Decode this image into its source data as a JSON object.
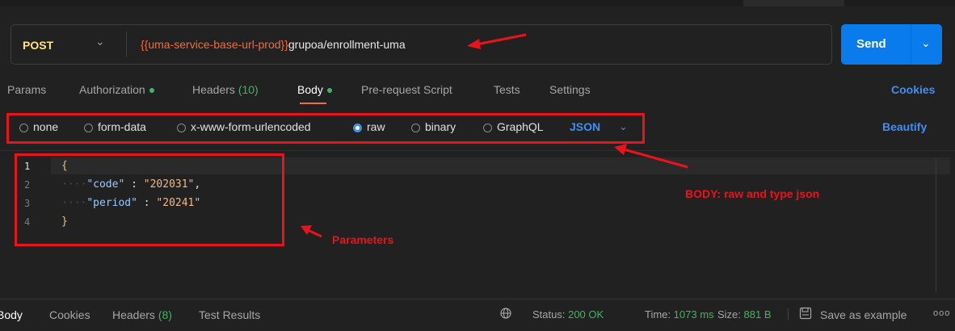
{
  "request": {
    "method": "POST",
    "url_var": "{{uma-service-base-url-prod}}",
    "url_path": "grupoa/enrollment-uma",
    "send_label": "Send"
  },
  "tabs": [
    {
      "label": "Params"
    },
    {
      "label": "Authorization",
      "dot": true
    },
    {
      "label": "Headers",
      "count": "(10)"
    },
    {
      "label": "Body",
      "dot": true,
      "active": true
    },
    {
      "label": "Pre-request Script"
    },
    {
      "label": "Tests"
    },
    {
      "label": "Settings"
    }
  ],
  "cookies_label": "Cookies",
  "body_types": {
    "none": "none",
    "form_data": "form-data",
    "urlencoded": "x-www-form-urlencoded",
    "raw": "raw",
    "binary": "binary",
    "graphql": "GraphQL",
    "selected": "raw"
  },
  "language_select": "JSON",
  "beautify_label": "Beautify",
  "editor": {
    "line_numbers": [
      "1",
      "2",
      "3",
      "4"
    ],
    "open_brace": "{",
    "close_brace": "}",
    "lines": [
      {
        "key": "\"code\"",
        "sep": " : ",
        "value": "\"202031\"",
        "trail": ","
      },
      {
        "key": "\"period\"",
        "sep": " : ",
        "value": "\"20241\"",
        "trail": ""
      }
    ]
  },
  "response": {
    "tabs": {
      "body": "Body",
      "cookies": "Cookies",
      "headers": "Headers",
      "headers_count": "(8)",
      "test_results": "Test Results"
    },
    "status_label": "Status:",
    "status_value": "200 OK",
    "time_label": "Time:",
    "time_value": "1073 ms",
    "size_label": "Size:",
    "size_value": "881 B",
    "save_label": "Save as example",
    "more": "ooo"
  },
  "annotations": {
    "body_note": "BODY: raw and type json",
    "params_note": "Parameters",
    "color": "#e8141c"
  },
  "colors": {
    "background": "#212121",
    "accent": "#097bed",
    "method": "#ffe47e",
    "variable": "#f26b3a",
    "success": "#3eb563",
    "link": "#3f8ef3"
  }
}
